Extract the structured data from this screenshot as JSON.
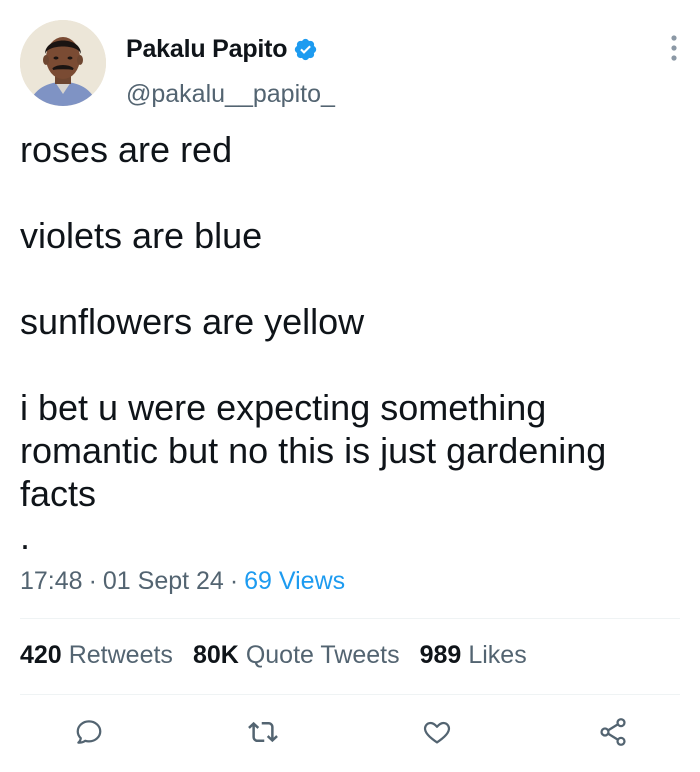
{
  "user": {
    "display_name": "Pakalu Papito",
    "handle": "@pakalu__papito_",
    "verified": true,
    "verified_color": "#1d9bf0"
  },
  "tweet": {
    "lines": [
      "roses are red",
      "violets are blue",
      "sunflowers are yellow",
      "i bet u were expecting something romantic but no this is just gardening facts",
      "."
    ]
  },
  "meta": {
    "time": "17:48",
    "separator": "·",
    "date": "01 Sept 24",
    "views": "69 Views",
    "views_color": "#1d9bf0"
  },
  "stats": {
    "retweets_count": "420",
    "retweets_label": "Retweets",
    "quotes_count": "80K",
    "quotes_label": "Quote Tweets",
    "likes_count": "989",
    "likes_label": "Likes"
  },
  "actions": [
    {
      "icon": "reply-icon"
    },
    {
      "icon": "retweet-icon"
    },
    {
      "icon": "like-icon"
    },
    {
      "icon": "share-icon"
    }
  ],
  "colors": {
    "text": "#0f1419",
    "secondary": "#536471",
    "divider": "#eff3f4",
    "icon": "#536471"
  }
}
